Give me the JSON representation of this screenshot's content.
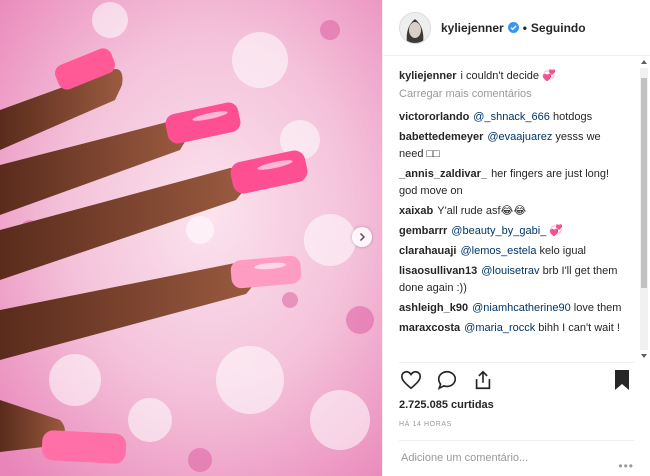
{
  "header": {
    "username": "kyliejenner",
    "separator": "•",
    "follow_label": "Seguindo"
  },
  "caption": {
    "username": "kyliejenner",
    "text": "i couldn't decide 💞"
  },
  "load_more_label": "Carregar mais comentários",
  "comments": [
    {
      "user": "victororlando",
      "mention": "@_shnack_666",
      "text": " hotdogs"
    },
    {
      "user": "babettedemeyer",
      "mention": "@evaajuarez",
      "text": " yesss we need □□"
    },
    {
      "user": "_annis_zaldivar_",
      "mention": "",
      "text": "her fingers are just long! god move on"
    },
    {
      "user": "xaixab",
      "mention": "",
      "text": "Y'all rude asf😂😂"
    },
    {
      "user": "gembarrr",
      "mention": "@beauty_by_gabi_",
      "text": " 💞"
    },
    {
      "user": "clarahauaji",
      "mention": "@lemos_estela",
      "text": " kelo igual"
    },
    {
      "user": "lisaosullivan13",
      "mention": "@louisetrav",
      "text": " brb I'll get them done again :))"
    },
    {
      "user": "ashleigh_k90",
      "mention": "@niamhcatherine90",
      "text": " love them"
    },
    {
      "user": "maraxcosta",
      "mention": "@maria_rocck",
      "text": " bihh I can't wait !"
    }
  ],
  "likes": "2.725.085 curtidas",
  "time": "HÁ 14 HORAS",
  "add_comment_placeholder": "Adicione um comentário...",
  "more_label": "•••",
  "icons": {
    "like": "heart-icon",
    "comment": "comment-icon",
    "share": "share-icon",
    "save": "bookmark-icon",
    "verified": "verified-badge-icon",
    "next": "chevron-right-icon"
  },
  "colors": {
    "nail_pink": "#ff4f93",
    "nail_light": "#ff9cc2",
    "foam_pink": "#f3b6d4",
    "verified_blue": "#3897f0",
    "mention": "#003569"
  }
}
